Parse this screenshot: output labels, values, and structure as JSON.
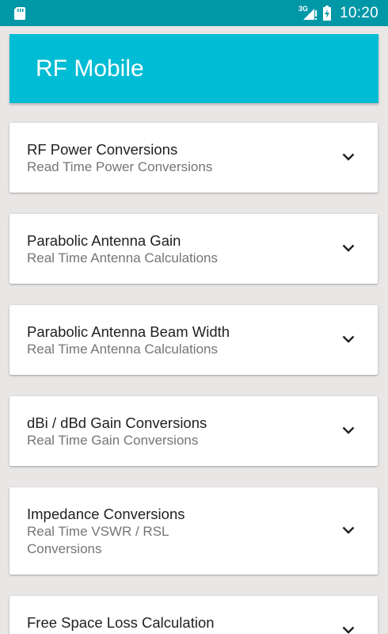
{
  "status_bar": {
    "network": "3G",
    "time": "10:20",
    "icons": [
      "sd-card-icon",
      "signal-icon",
      "battery-icon"
    ]
  },
  "app_bar": {
    "title": "RF Mobile",
    "color": "#00bcd4"
  },
  "cards": [
    {
      "title": "RF Power Conversions",
      "subtitle": "Read Time Power Conversions",
      "icon": "chevron-down-icon"
    },
    {
      "title": "Parabolic Antenna Gain",
      "subtitle": "Real Time Antenna Calculations",
      "icon": "chevron-down-icon"
    },
    {
      "title": "Parabolic Antenna Beam Width",
      "subtitle": "Real Time Antenna Calculations",
      "icon": "chevron-down-icon"
    },
    {
      "title": "dBi / dBd Gain Conversions",
      "subtitle": "Real Time Gain Conversions",
      "icon": "chevron-down-icon"
    },
    {
      "title": "Impedance Conversions",
      "subtitle": "Real Time VSWR / RSL Conversions",
      "icon": "chevron-down-icon"
    },
    {
      "title": "Free Space Loss Calculation",
      "subtitle": "",
      "icon": "chevron-down-icon"
    }
  ]
}
